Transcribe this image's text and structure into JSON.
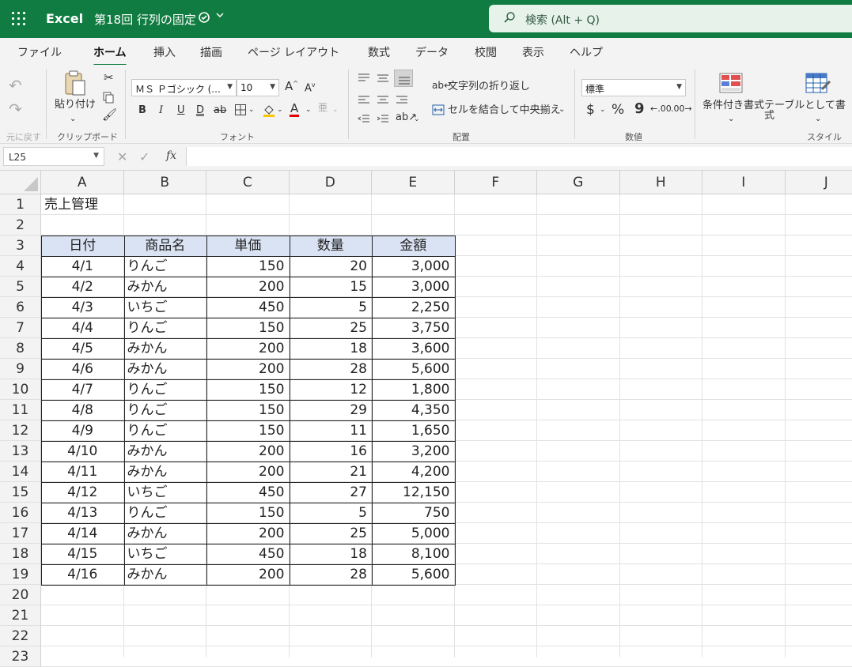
{
  "titlebar": {
    "app_name": "Excel",
    "doc_name": "第18回 行列の固定",
    "search_text": "検索 (Alt + Q)",
    "bg_color": "#107c41"
  },
  "tabs": [
    "ファイル",
    "ホーム",
    "挿入",
    "描画",
    "ページ レイアウト",
    "数式",
    "データ",
    "校閲",
    "表示",
    "ヘルプ"
  ],
  "active_tab": "ホーム",
  "ribbon": {
    "undo_group_label": "元に戻す",
    "paste_label": "貼り付け",
    "clipboard_label": "クリップボード",
    "font_name": "ＭＳ Ｐゴシック (...",
    "font_size": "10",
    "font_label": "フォント",
    "bold": "B",
    "italic": "I",
    "underline": "U",
    "double_underline": "D",
    "strikethrough": "ab",
    "font_color_glyph": "A",
    "grow_font": "A",
    "shrink_font": "A",
    "wrap_text": "文字列の折り返し",
    "merge_center": "セルを結合して中央揃え",
    "alignment_label": "配置",
    "number_format": "標準",
    "currency": "$",
    "percent": "%",
    "comma": "9",
    "increase_decimal": ".00",
    "decrease_decimal": ".00",
    "number_label": "数値",
    "conditional_format": "条件付き書式",
    "format_as_table": "テーブルとして書式",
    "styles_label": "スタイル"
  },
  "formula_bar": {
    "name_box": "L25",
    "fx": "fx",
    "value": ""
  },
  "sheet": {
    "columns": [
      "A",
      "B",
      "C",
      "D",
      "E",
      "F",
      "G",
      "H",
      "I",
      "J"
    ],
    "rows": [
      "1",
      "2",
      "3",
      "4",
      "5",
      "6",
      "7",
      "8",
      "9",
      "10",
      "11",
      "12",
      "13",
      "14",
      "15",
      "16",
      "17",
      "18",
      "19",
      "20",
      "21",
      "22",
      "23"
    ],
    "title": "売上管理",
    "headers": [
      "日付",
      "商品名",
      "単価",
      "数量",
      "金額"
    ],
    "data": [
      [
        "4/1",
        "りんご",
        "150",
        "20",
        "3,000"
      ],
      [
        "4/2",
        "みかん",
        "200",
        "15",
        "3,000"
      ],
      [
        "4/3",
        "いちご",
        "450",
        "5",
        "2,250"
      ],
      [
        "4/4",
        "りんご",
        "150",
        "25",
        "3,750"
      ],
      [
        "4/5",
        "みかん",
        "200",
        "18",
        "3,600"
      ],
      [
        "4/6",
        "みかん",
        "200",
        "28",
        "5,600"
      ],
      [
        "4/7",
        "りんご",
        "150",
        "12",
        "1,800"
      ],
      [
        "4/8",
        "りんご",
        "150",
        "29",
        "4,350"
      ],
      [
        "4/9",
        "りんご",
        "150",
        "11",
        "1,650"
      ],
      [
        "4/10",
        "みかん",
        "200",
        "16",
        "3,200"
      ],
      [
        "4/11",
        "みかん",
        "200",
        "21",
        "4,200"
      ],
      [
        "4/12",
        "いちご",
        "450",
        "27",
        "12,150"
      ],
      [
        "4/13",
        "りんご",
        "150",
        "5",
        "750"
      ],
      [
        "4/14",
        "みかん",
        "200",
        "25",
        "5,000"
      ],
      [
        "4/15",
        "いちご",
        "450",
        "18",
        "8,100"
      ],
      [
        "4/16",
        "みかん",
        "200",
        "28",
        "5,600"
      ]
    ],
    "header_fill": "#dae3f3"
  }
}
